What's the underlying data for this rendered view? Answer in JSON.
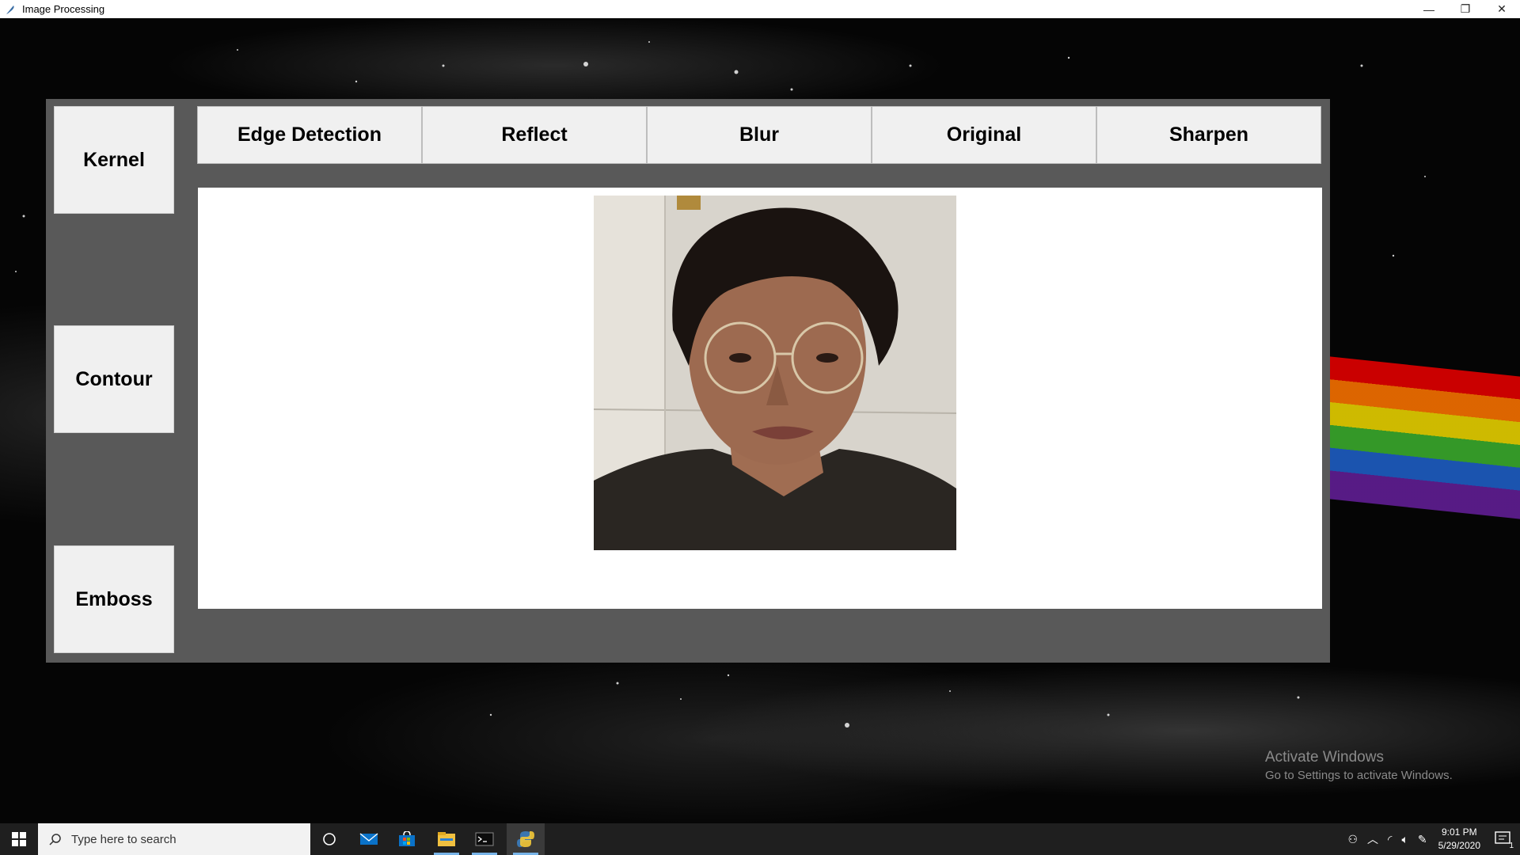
{
  "window": {
    "title": "Image Processing",
    "controls": {
      "minimize": "—",
      "restore": "❐",
      "close": "✕"
    }
  },
  "sidebar": {
    "buttons": [
      {
        "label": "Kernel"
      },
      {
        "label": "Contour"
      },
      {
        "label": "Emboss"
      }
    ]
  },
  "toolbar": {
    "buttons": [
      {
        "label": "Edge Detection"
      },
      {
        "label": "Reflect"
      },
      {
        "label": "Blur"
      },
      {
        "label": "Original"
      },
      {
        "label": "Sharpen"
      }
    ]
  },
  "watermark": {
    "line1": "Activate Windows",
    "line2": "Go to Settings to activate Windows."
  },
  "taskbar": {
    "search_placeholder": "Type here to search",
    "time": "9:01 PM",
    "date": "5/29/2020",
    "notification_count": "1",
    "pinned": [
      "start-icon",
      "cortana-icon",
      "mail-icon",
      "store-icon",
      "file-explorer-icon",
      "terminal-icon",
      "python-icon"
    ]
  },
  "colors": {
    "panel": "#595959",
    "button": "#f0f0f0",
    "canvas": "#ffffff",
    "taskbar": "#1f1f1f"
  }
}
